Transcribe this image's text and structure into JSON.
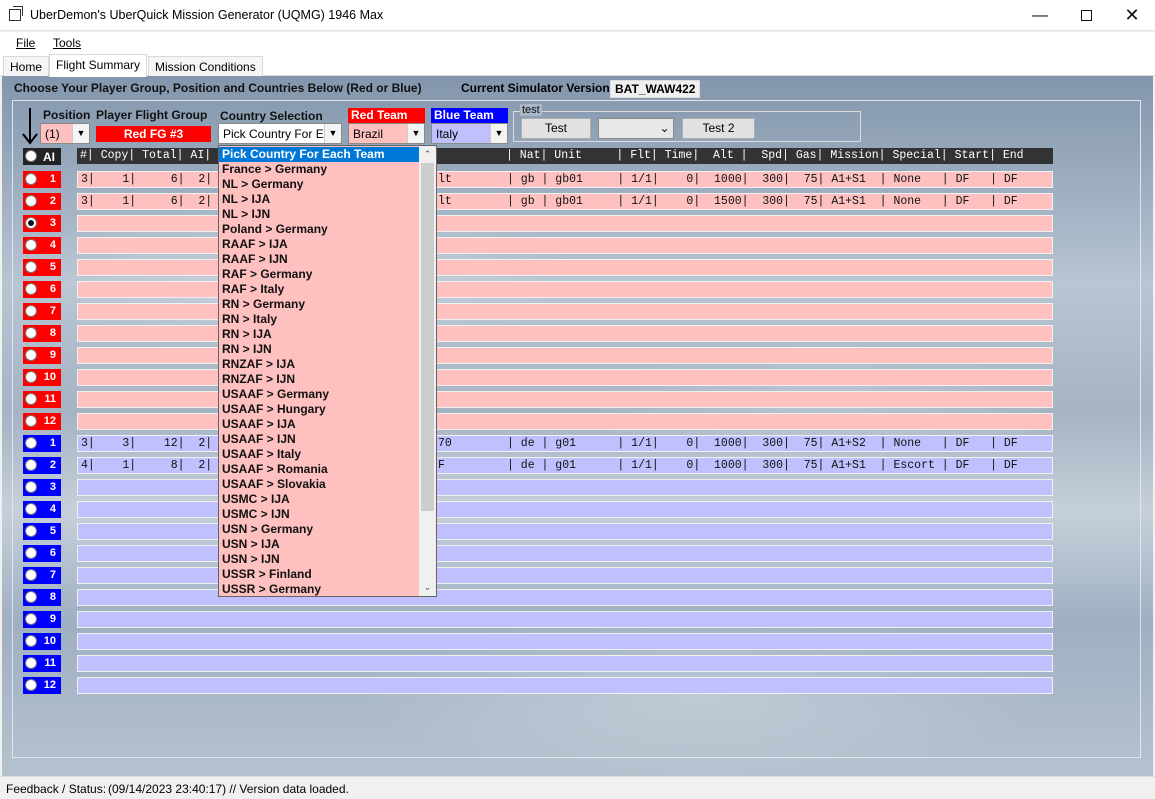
{
  "window": {
    "title": "UberDemon's UberQuick Mission Generator (UQMG) 1946 Max"
  },
  "menu": {
    "file": "File",
    "tools": "Tools"
  },
  "tabs": {
    "home": "Home",
    "flight_summary": "Flight Summary",
    "mission_conditions": "Mission Conditions"
  },
  "header": {
    "instruction": "Choose Your Player Group, Position and Countries Below (Red or Blue)",
    "sim_label": "Current Simulator Version:",
    "sim_value": "BAT_WAW422"
  },
  "controls": {
    "position_label": "Position",
    "position_value": "(1)",
    "player_fg_label": "Player Flight Group",
    "player_fg_value": "Red FG #3",
    "country_label": "Country Selection",
    "country_value": "Pick Country For E",
    "red_team_label": "Red Team",
    "red_team_value": "Brazil",
    "blue_team_label": "Blue Team",
    "blue_team_value": "Italy",
    "test_group_label": "test",
    "test_button": "Test",
    "test_combo_value": "",
    "test2_button": "Test 2"
  },
  "table": {
    "ai_label": "AI",
    "header_left": "#| Copy| Total| AI|",
    "header_right": "| Nat| Unit     | Flt| Time|  Alt |  Spd| Gas| Mission| Special| Start| End",
    "red_rows": [
      {
        "num": "1",
        "left": "3|    1|     6|  2|",
        "mid": "lt",
        "right": "| gb | gb01     | 1/1|    0|  1000|  300|  75| A1+S1  | None   | DF   | DF"
      },
      {
        "num": "2",
        "left": "3|    1|     6|  2|",
        "mid": "lt",
        "right": "| gb | gb01     | 1/1|    0|  1500|  300|  75| A1+S1  | None   | DF   | DF"
      },
      {
        "num": "3",
        "left": "",
        "mid": "",
        "right": ""
      },
      {
        "num": "4",
        "left": "",
        "mid": "",
        "right": ""
      },
      {
        "num": "5",
        "left": "",
        "mid": "",
        "right": ""
      },
      {
        "num": "6",
        "left": "",
        "mid": "",
        "right": ""
      },
      {
        "num": "7",
        "left": "",
        "mid": "",
        "right": ""
      },
      {
        "num": "8",
        "left": "",
        "mid": "",
        "right": ""
      },
      {
        "num": "9",
        "left": "",
        "mid": "",
        "right": ""
      },
      {
        "num": "10",
        "left": "",
        "mid": "",
        "right": ""
      },
      {
        "num": "11",
        "left": "",
        "mid": "",
        "right": ""
      },
      {
        "num": "12",
        "left": "",
        "mid": "",
        "right": ""
      }
    ],
    "blue_rows": [
      {
        "num": "1",
        "left": "3|    3|    12|  2|",
        "mid": "70",
        "right": "| de | g01      | 1/1|    0|  1000|  300|  75| A1+S2  | None   | DF   | DF"
      },
      {
        "num": "2",
        "left": "4|    1|     8|  2|",
        "mid": "F",
        "right": "| de | g01      | 1/1|    0|  1000|  300|  75| A1+S1  | Escort | DF   | DF"
      },
      {
        "num": "3",
        "left": "",
        "mid": "",
        "right": ""
      },
      {
        "num": "4",
        "left": "",
        "mid": "",
        "right": ""
      },
      {
        "num": "5",
        "left": "",
        "mid": "",
        "right": ""
      },
      {
        "num": "6",
        "left": "",
        "mid": "",
        "right": ""
      },
      {
        "num": "7",
        "left": "",
        "mid": "",
        "right": ""
      },
      {
        "num": "8",
        "left": "",
        "mid": "",
        "right": ""
      },
      {
        "num": "9",
        "left": "",
        "mid": "",
        "right": ""
      },
      {
        "num": "10",
        "left": "",
        "mid": "",
        "right": ""
      },
      {
        "num": "11",
        "left": "",
        "mid": "",
        "right": ""
      },
      {
        "num": "12",
        "left": "",
        "mid": "",
        "right": ""
      }
    ],
    "selected_red_row": "3"
  },
  "country_dropdown": {
    "items": [
      "Pick Country For Each Team",
      "France > Germany",
      "NL > Germany",
      "NL > IJA",
      "NL > IJN",
      "Poland > Germany",
      "RAAF > IJA",
      "RAAF > IJN",
      "RAF > Germany",
      "RAF > Italy",
      "RN > Germany",
      "RN > Italy",
      "RN > IJA",
      "RN > IJN",
      "RNZAF > IJA",
      "RNZAF > IJN",
      "USAAF > Germany",
      "USAAF > Hungary",
      "USAAF > IJA",
      "USAAF > IJN",
      "USAAF > Italy",
      "USAAF > Romania",
      "USAAF > Slovakia",
      "USMC > IJA",
      "USMC > IJN",
      "USN > Germany",
      "USN > IJA",
      "USN > IJN",
      "USSR > Finland",
      "USSR > Germany"
    ],
    "selected": "Pick Country For Each Team"
  },
  "status": {
    "label": "Feedback / Status:",
    "message": "(09/14/2023 23:40:17) // Version data loaded."
  },
  "colors": {
    "red_team": "#ff0000",
    "blue_team": "#0000ff",
    "red_row": "#ffc0c0",
    "blue_row": "#c0c0ff",
    "selection": "#0078d7"
  }
}
